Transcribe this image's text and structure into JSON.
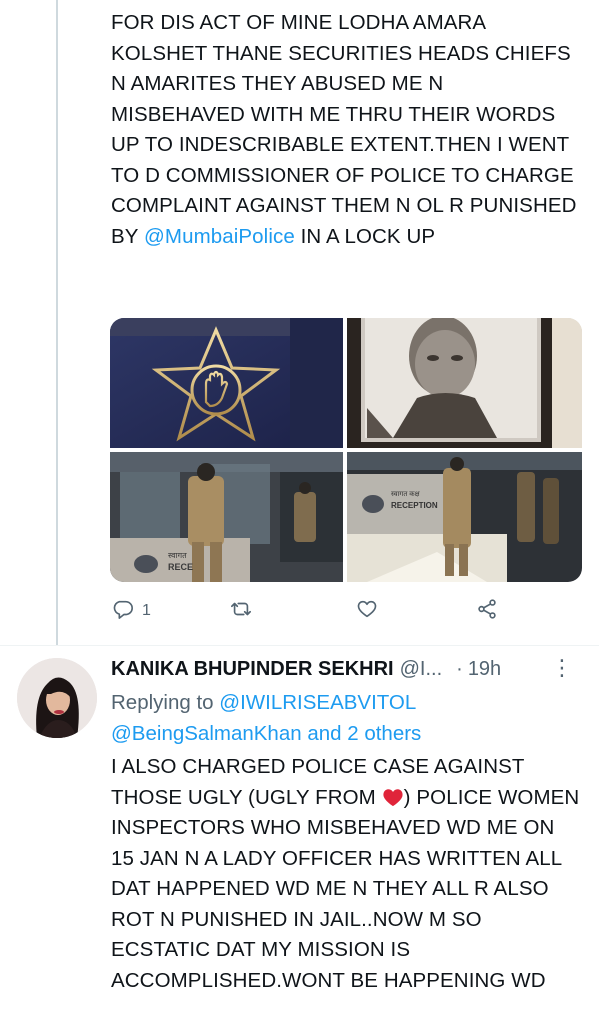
{
  "tweet1": {
    "text_before_mention": "FOR DIS ACT OF MINE LODHA AMARA KOLSHET THANE SECURITIES HEADS CHIEFS N AMARITES THEY ABUSED ME N MISBEHAVED WITH ME THRU THEIR WORDS UP TO INDESCRIBABLE EXTENT.THEN I WENT TO D COMMISSIONER OF POLICE TO CHARGE COMPLAINT AGAINST THEM N OL R PUNISHED BY ",
    "mention": "@MumbaiPolice",
    "text_after_mention": " IN A LOCK UP",
    "media_signs": [
      "स्वागत कक्ष",
      "RECEPTION",
      "स्वागत",
      "RECE"
    ],
    "actions": {
      "reply_count": "1",
      "retweet_count": "",
      "like_count": ""
    }
  },
  "tweet2": {
    "name": "KANIKA BHUPINDER SEKHRI",
    "handle": "@I...",
    "time_sep": "·",
    "time": "19h",
    "more": "⋮",
    "replying_prefix": "Replying to ",
    "replying_to": [
      "@IWILRISEABVITOL",
      "@BeingSalmanKhan"
    ],
    "replying_suffix": " and 2 others",
    "text_part1": "I ALSO CHARGED POLICE CASE AGAINST THOSE UGLY (UGLY FROM ",
    "text_part2": ") POLICE WOMEN INSPECTORS WHO MISBEHAVED WD ME ON 15 JAN N A LADY OFFICER HAS WRITTEN ALL DAT HAPPENED WD ME N THEY ALL R ALSO ROT N PUNISHED IN JAIL..NOW M SO ECSTATIC DAT MY MISSION IS ACCOMPLISHED.WONT BE HAPPENING WD"
  },
  "icons": {
    "reply": "reply-icon",
    "retweet": "retweet-icon",
    "like": "heart-icon",
    "share": "share-icon",
    "emoji": "red-heart-emoji"
  },
  "colors": {
    "link": "#1d9bf0",
    "secondary": "#536471",
    "text": "#0f1419",
    "heart_emoji": "#e0243a"
  }
}
